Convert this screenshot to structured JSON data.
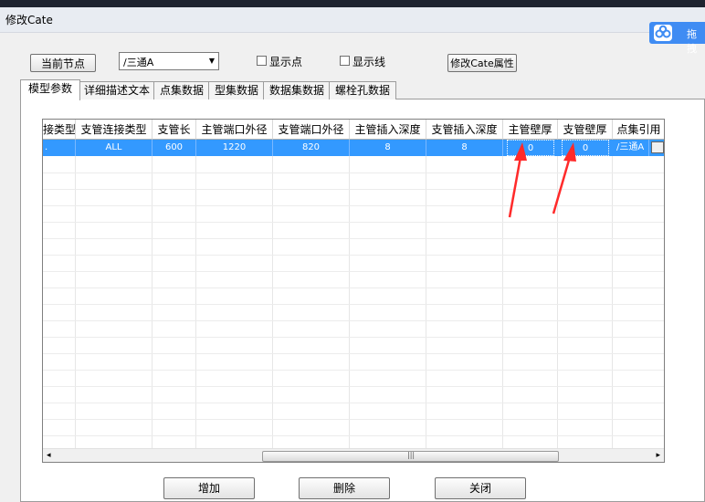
{
  "window": {
    "title": "修改Cate"
  },
  "float_tool": {
    "label": "拖拽",
    "icon": "cloud-link-icon",
    "color": "#3f8cf3"
  },
  "toolbar": {
    "current_node_label": "当前节点",
    "node_combo_value": "/三通A",
    "show_points_label": "显示点",
    "show_lines_label": "显示线",
    "modify_props_label": "修改Cate属性"
  },
  "tabs": [
    {
      "label": "模型参数",
      "active": true
    },
    {
      "label": "详细描述文本",
      "active": false
    },
    {
      "label": "点集数据",
      "active": false
    },
    {
      "label": "型集数据",
      "active": false
    },
    {
      "label": "数据集数据",
      "active": false
    },
    {
      "label": "螺栓孔数据",
      "active": false
    }
  ],
  "grid": {
    "headers": [
      "接类型",
      "支管连接类型",
      "支管长",
      "主管端口外径",
      "支管端口外径",
      "主管插入深度",
      "支管插入深度",
      "主管壁厚",
      "支管壁厚",
      "点集引用"
    ],
    "row": [
      "",
      "ALL",
      "600",
      "1220",
      "820",
      "8",
      "8",
      "0",
      "0",
      "/三通A"
    ],
    "selection_color": "#3399ff"
  },
  "annotation_color": "#ff2a2a",
  "footer": {
    "add_label": "增加",
    "delete_label": "删除",
    "close_label": "关闭"
  }
}
